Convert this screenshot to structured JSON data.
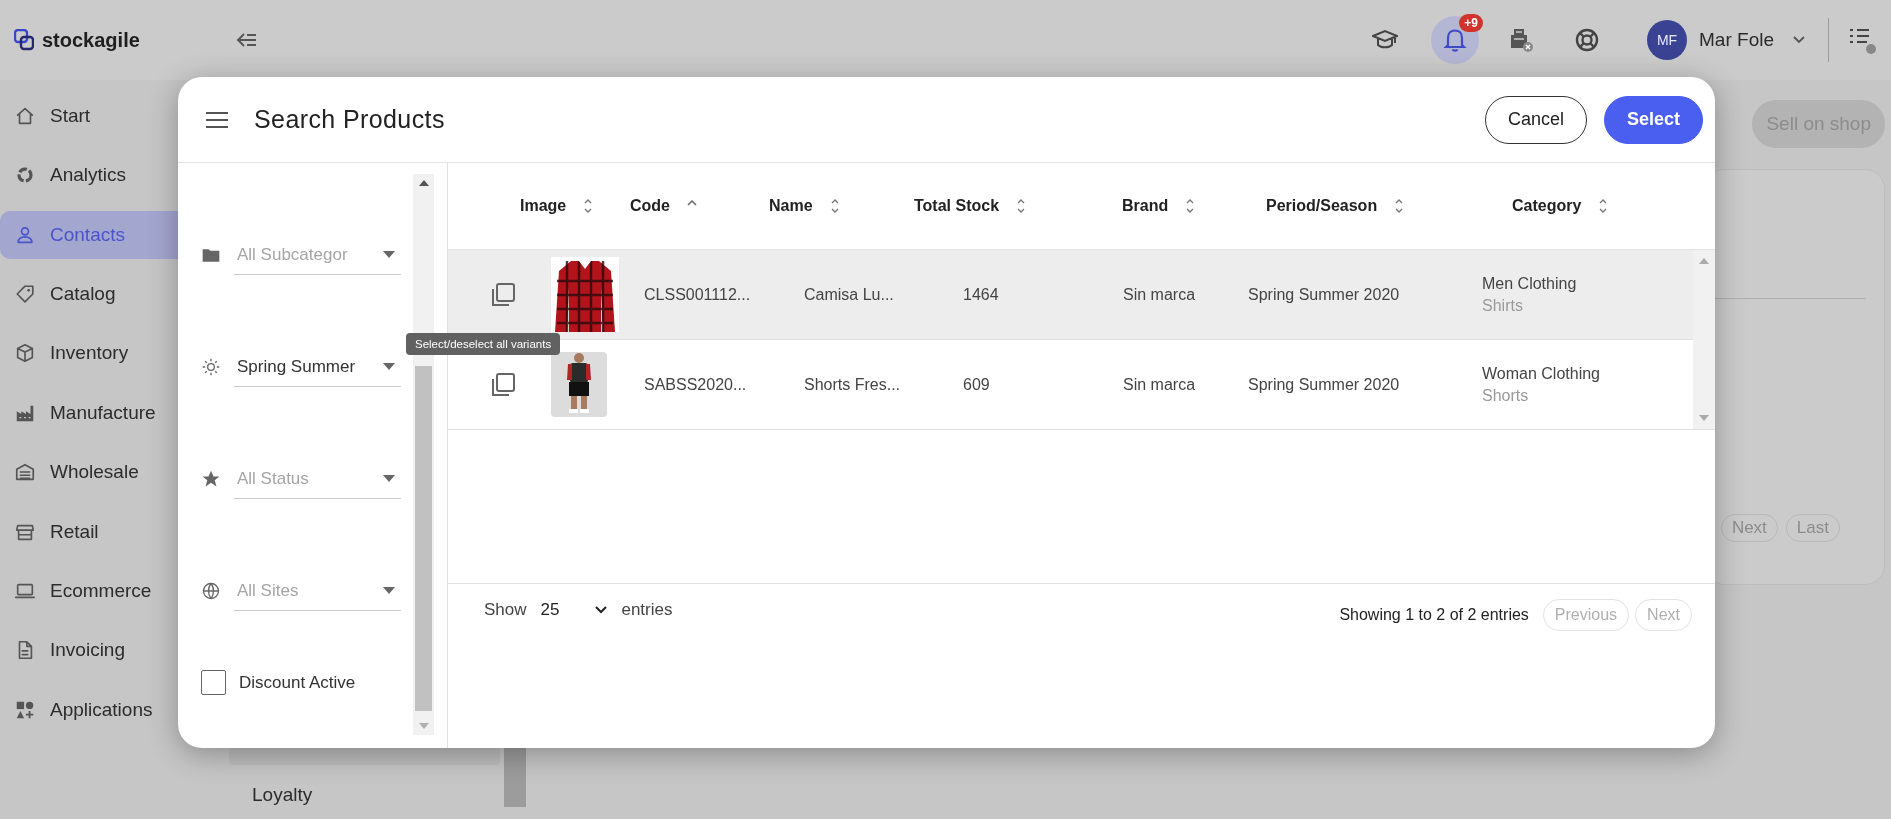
{
  "topbar": {
    "logo": "stockagile",
    "notifications": {
      "badge": "+9",
      "active": true
    },
    "user": {
      "initials": "MF",
      "name": "Mar Fole"
    }
  },
  "sidebar": {
    "items": [
      {
        "label": "Start",
        "selected": false
      },
      {
        "label": "Analytics",
        "selected": false
      },
      {
        "label": "Contacts",
        "selected": true
      },
      {
        "label": "Catalog",
        "selected": false
      },
      {
        "label": "Inventory",
        "selected": false
      },
      {
        "label": "Manufacture",
        "selected": false
      },
      {
        "label": "Wholesale",
        "selected": false
      },
      {
        "label": "Retail",
        "selected": false
      },
      {
        "label": "Ecommerce",
        "selected": false
      },
      {
        "label": "Invoicing",
        "selected": false
      },
      {
        "label": "Applications",
        "selected": false
      }
    ],
    "submenu": [
      {
        "label": "Loyalty"
      }
    ]
  },
  "background": {
    "buttons": [
      {
        "label": "Sell on shop",
        "disabled": true
      }
    ],
    "pagination": [
      {
        "label": "Next"
      },
      {
        "label": "Last"
      }
    ]
  },
  "modal": {
    "title": "Search Products",
    "buttons": [
      {
        "label": "Cancel",
        "kind": "outline"
      },
      {
        "label": "Select",
        "kind": "primary"
      }
    ],
    "filters": [
      {
        "placeholder": "All Subcategor"
      },
      {
        "value": "Spring Summer"
      },
      {
        "placeholder": "All Status"
      },
      {
        "placeholder": "All Sites"
      }
    ],
    "discount": {
      "label": "Discount Active",
      "checked": false
    },
    "table": {
      "columns": [
        {
          "label": "Image",
          "sorted": false
        },
        {
          "label": "Code",
          "sorted": true
        },
        {
          "label": "Name",
          "sorted": false
        },
        {
          "label": "Total Stock",
          "sorted": false
        },
        {
          "label": "Brand",
          "sorted": false
        },
        {
          "label": "Period/Season",
          "sorted": false
        },
        {
          "label": "Category",
          "sorted": false
        }
      ],
      "rows": [
        {
          "code": "CLSS001112...",
          "name": "Camisa Lu...",
          "total_stock": "1464",
          "brand": "Sin marca",
          "period": "Spring Summer 2020",
          "category": "Men Clothing",
          "subcategory": "Shirts",
          "hovered": true
        },
        {
          "code": "SABSS2020...",
          "name": "Shorts Fres...",
          "total_stock": "609",
          "brand": "Sin marca",
          "period": "Spring Summer 2020",
          "category": "Woman Clothing",
          "subcategory": "Shorts",
          "hovered": false
        }
      ]
    },
    "tooltip": "Select/deselect all variants",
    "footer": {
      "show_label": "Show",
      "page_size": "25",
      "entries_label": "entries",
      "info": "Showing 1 to 2 of 2 entries",
      "pagination": [
        {
          "label": "Previous",
          "disabled": true
        },
        {
          "label": "Next",
          "disabled": true
        }
      ]
    }
  }
}
